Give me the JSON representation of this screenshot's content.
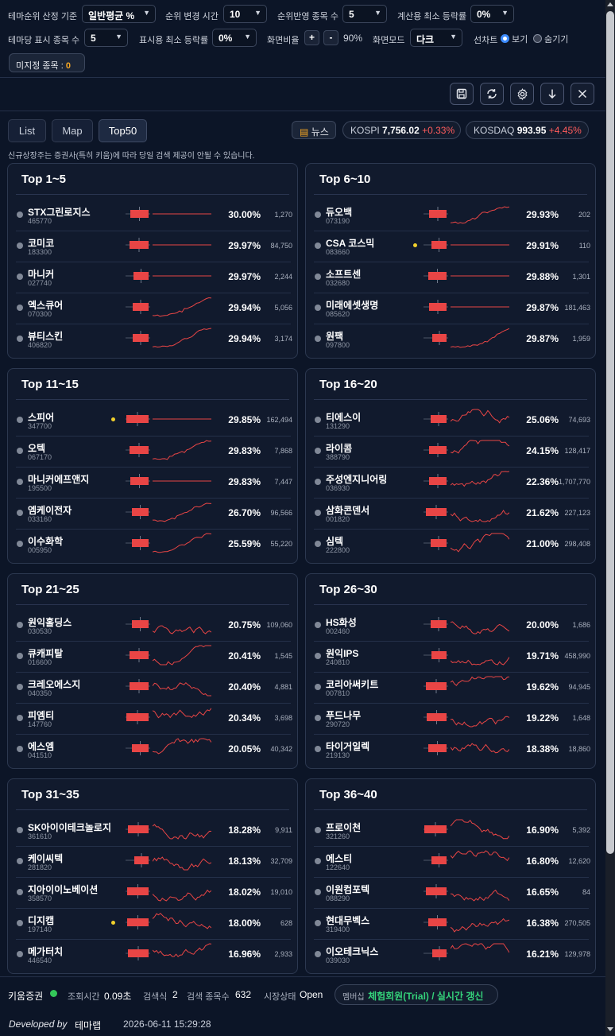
{
  "settings": {
    "row1": [
      {
        "label": "테마순위 산정 기준",
        "value": "일반평균 %"
      },
      {
        "label": "순위 변경 시간",
        "value": "10"
      },
      {
        "label": "순위반영 종목 수",
        "value": "5"
      },
      {
        "label": "계산용 최소 등락률",
        "value": "0%"
      }
    ],
    "row2": [
      {
        "label": "테마당 표시 종목 수",
        "value": "5"
      },
      {
        "label": "표시용 최소 등락률",
        "value": "0%"
      }
    ],
    "screen_ratio_label": "화면비율",
    "zoom_plus": "+",
    "zoom_minus": "-",
    "zoom_value": "90%",
    "screen_mode_label": "화면모드",
    "screen_mode_value": "다크",
    "line_chart_label": "선차트",
    "radio_show": "보기",
    "radio_hide": "숨기기",
    "unassigned_label": "미지정 종목 :",
    "unassigned_count": "0"
  },
  "toolbar": {
    "icons": [
      "save-icon",
      "refresh-icon",
      "gear-icon",
      "download-icon",
      "close-icon"
    ]
  },
  "tabs": {
    "list": "List",
    "map": "Map",
    "top50": "Top50",
    "active": "Top50"
  },
  "news_label": "뉴스",
  "indices": [
    {
      "name": "KOSPI",
      "value": "7,756.02",
      "change": "+0.33%"
    },
    {
      "name": "KOSDAQ",
      "value": "993.95",
      "change": "+4.45%"
    }
  ],
  "notice": "신규상장주는 증권사(특히 키움)에 따라 당일 검색 제공이 안될 수 있습니다.",
  "panels": [
    {
      "title": "Top 1~5",
      "rows": [
        {
          "name": "STX그린로지스",
          "code": "465770",
          "pct": "30.00%",
          "vol": "1,270",
          "dot": false
        },
        {
          "name": "코미코",
          "code": "183300",
          "pct": "29.97%",
          "vol": "84,750",
          "dot": false
        },
        {
          "name": "마니커",
          "code": "027740",
          "pct": "29.97%",
          "vol": "2,244",
          "dot": false
        },
        {
          "name": "엑스큐어",
          "code": "070300",
          "pct": "29.94%",
          "vol": "5,056",
          "dot": false
        },
        {
          "name": "뷰티스킨",
          "code": "406820",
          "pct": "29.94%",
          "vol": "3,174",
          "dot": false
        }
      ]
    },
    {
      "title": "Top 6~10",
      "rows": [
        {
          "name": "듀오백",
          "code": "073190",
          "pct": "29.93%",
          "vol": "202",
          "dot": false
        },
        {
          "name": "CSA 코스믹",
          "code": "083660",
          "pct": "29.91%",
          "vol": "110",
          "dot": true
        },
        {
          "name": "소프트센",
          "code": "032680",
          "pct": "29.88%",
          "vol": "1,301",
          "dot": false
        },
        {
          "name": "미래에셋생명",
          "code": "085620",
          "pct": "29.87%",
          "vol": "181,463",
          "dot": false
        },
        {
          "name": "원팩",
          "code": "097800",
          "pct": "29.87%",
          "vol": "1,959",
          "dot": false
        }
      ]
    },
    {
      "title": "Top 11~15",
      "rows": [
        {
          "name": "스피어",
          "code": "347700",
          "pct": "29.85%",
          "vol": "162,494",
          "dot": true
        },
        {
          "name": "오텍",
          "code": "067170",
          "pct": "29.83%",
          "vol": "7,868",
          "dot": false
        },
        {
          "name": "마니커에프앤지",
          "code": "195500",
          "pct": "29.83%",
          "vol": "7,447",
          "dot": false
        },
        {
          "name": "엠케이전자",
          "code": "033160",
          "pct": "26.70%",
          "vol": "96,566",
          "dot": false
        },
        {
          "name": "이수화학",
          "code": "005950",
          "pct": "25.59%",
          "vol": "55,220",
          "dot": false
        }
      ]
    },
    {
      "title": "Top 16~20",
      "rows": [
        {
          "name": "티에스이",
          "code": "131290",
          "pct": "25.06%",
          "vol": "74,693",
          "dot": false
        },
        {
          "name": "라이콤",
          "code": "388790",
          "pct": "24.15%",
          "vol": "128,417",
          "dot": false
        },
        {
          "name": "주성엔지니어링",
          "code": "036930",
          "pct": "22.36%",
          "vol": "1,707,770",
          "dot": false
        },
        {
          "name": "삼화콘덴서",
          "code": "001820",
          "pct": "21.62%",
          "vol": "227,123",
          "dot": false
        },
        {
          "name": "심텍",
          "code": "222800",
          "pct": "21.00%",
          "vol": "298,408",
          "dot": false
        }
      ]
    },
    {
      "title": "Top 21~25",
      "rows": [
        {
          "name": "원익홀딩스",
          "code": "030530",
          "pct": "20.75%",
          "vol": "109,060",
          "dot": false
        },
        {
          "name": "큐캐피탈",
          "code": "016600",
          "pct": "20.41%",
          "vol": "1,545",
          "dot": false
        },
        {
          "name": "크레오에스지",
          "code": "040350",
          "pct": "20.40%",
          "vol": "4,881",
          "dot": false
        },
        {
          "name": "피엠티",
          "code": "147760",
          "pct": "20.34%",
          "vol": "3,698",
          "dot": false
        },
        {
          "name": "에스엠",
          "code": "041510",
          "pct": "20.05%",
          "vol": "40,342",
          "dot": false
        }
      ]
    },
    {
      "title": "Top 26~30",
      "rows": [
        {
          "name": "HS화성",
          "code": "002460",
          "pct": "20.00%",
          "vol": "1,686",
          "dot": false
        },
        {
          "name": "원익IPS",
          "code": "240810",
          "pct": "19.71%",
          "vol": "458,990",
          "dot": false
        },
        {
          "name": "코리아써키트",
          "code": "007810",
          "pct": "19.62%",
          "vol": "94,945",
          "dot": false
        },
        {
          "name": "푸드나무",
          "code": "290720",
          "pct": "19.22%",
          "vol": "1,648",
          "dot": false
        },
        {
          "name": "타이거일렉",
          "code": "219130",
          "pct": "18.38%",
          "vol": "18,860",
          "dot": false
        }
      ]
    },
    {
      "title": "Top 31~35",
      "rows": [
        {
          "name": "SK아이이테크놀로지",
          "code": "361610",
          "pct": "18.28%",
          "vol": "9,911",
          "dot": false
        },
        {
          "name": "케이씨텍",
          "code": "281820",
          "pct": "18.13%",
          "vol": "32,709",
          "dot": false
        },
        {
          "name": "지아이이노베이션",
          "code": "358570",
          "pct": "18.02%",
          "vol": "19,010",
          "dot": false
        },
        {
          "name": "디지캡",
          "code": "197140",
          "pct": "18.00%",
          "vol": "628",
          "dot": true
        },
        {
          "name": "메가터치",
          "code": "446540",
          "pct": "16.96%",
          "vol": "2,933",
          "dot": false
        }
      ]
    },
    {
      "title": "Top 36~40",
      "rows": [
        {
          "name": "프로이천",
          "code": "321260",
          "pct": "16.90%",
          "vol": "5,392",
          "dot": false
        },
        {
          "name": "에스티",
          "code": "122640",
          "pct": "16.80%",
          "vol": "12,620",
          "dot": false
        },
        {
          "name": "이원컴포텍",
          "code": "088290",
          "pct": "16.65%",
          "vol": "84",
          "dot": false
        },
        {
          "name": "현대무벡스",
          "code": "319400",
          "pct": "16.38%",
          "vol": "270,505",
          "dot": false
        },
        {
          "name": "이오테크닉스",
          "code": "039030",
          "pct": "16.21%",
          "vol": "129,978",
          "dot": false
        }
      ]
    }
  ],
  "footer": {
    "broker": "키움증권",
    "query_time_label": "조회시간",
    "query_time": "0.09초",
    "search_count_label": "검색식",
    "search_count": "2",
    "search_items_label": "검색 종목수",
    "search_items": "632",
    "market_status_label": "시장상태",
    "market_status": "Open",
    "membership_label": "멤버십",
    "membership_value": "체험회원(Trial) / 실시간 갱신",
    "developed_by": "Developed by",
    "dev_name": "테마랩",
    "timestamp": "2026-06-11 15:29:28"
  },
  "colors": {
    "bg": "#0c1527",
    "panel": "#111a2d",
    "up": "#e84545",
    "green": "#34c759",
    "accent_orange": "#f5a623"
  }
}
